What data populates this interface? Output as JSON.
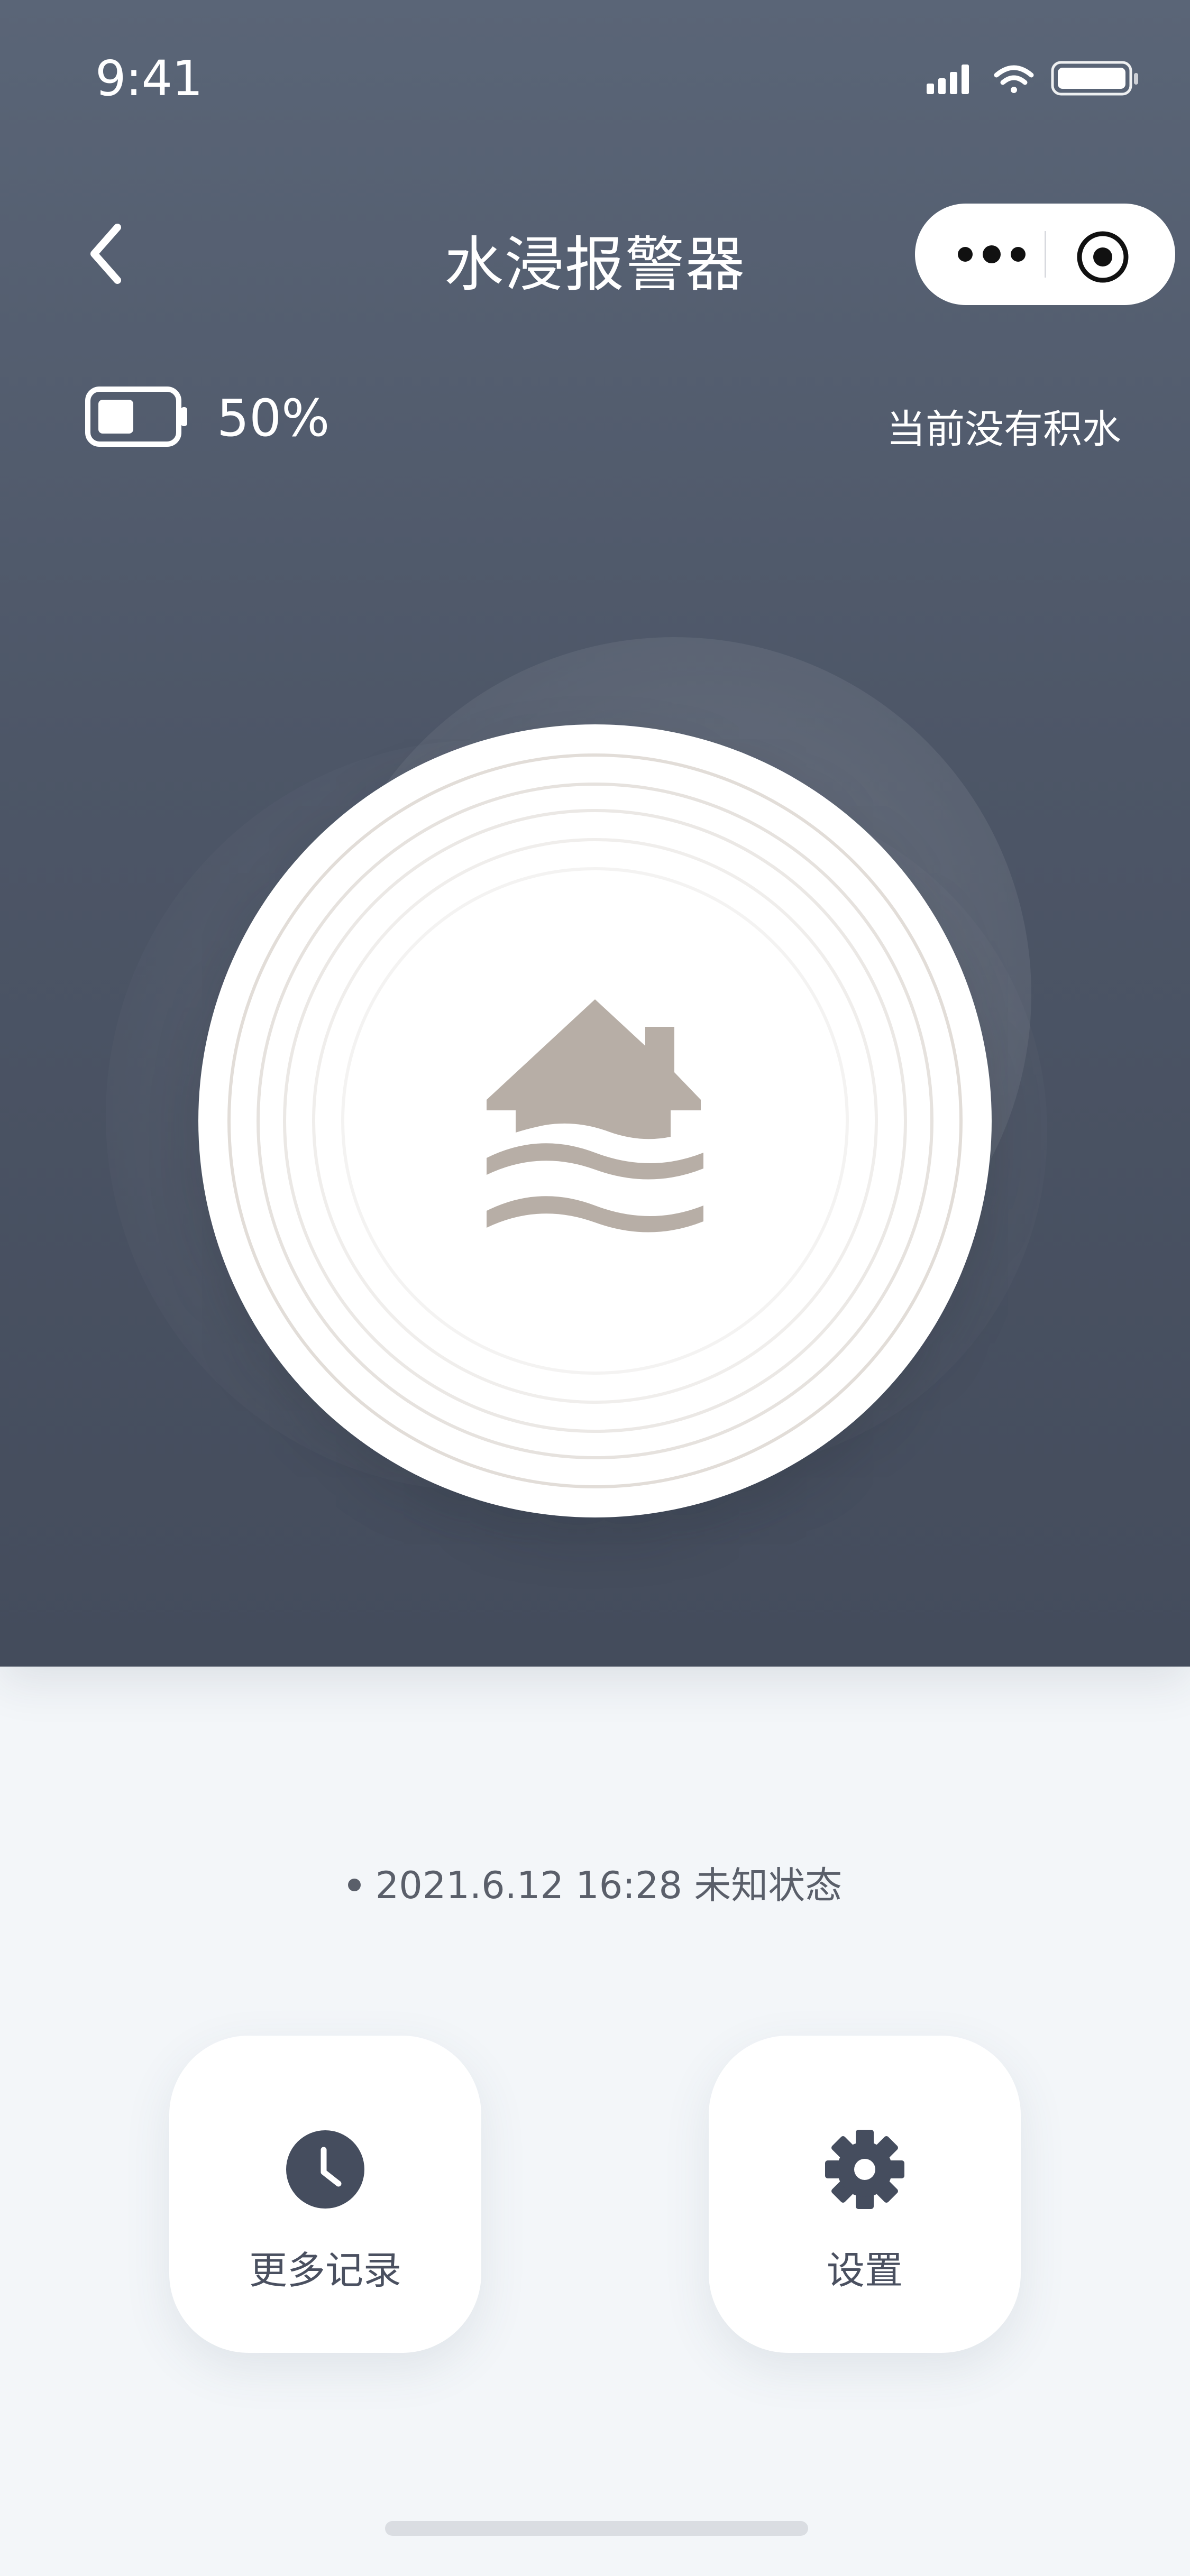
{
  "status_bar": {
    "time": "9:41"
  },
  "nav": {
    "title": "水浸报警器"
  },
  "device": {
    "battery_percent": "50%",
    "battery_level": 0.5,
    "water_status": "当前没有积水"
  },
  "record": {
    "timestamp": "2021.6.12 16:28",
    "state": "未知状态"
  },
  "actions": [
    {
      "label": "更多记录",
      "icon": "clock-icon"
    },
    {
      "label": "设置",
      "icon": "gear-icon"
    }
  ],
  "colors": {
    "hero_top": "#5a6577",
    "hero_bottom": "#444c5c",
    "house": "#b7aea6",
    "ring": "#ddd8d3",
    "page_bg": "#f3f6f9",
    "icon_dark": "#454d5e"
  }
}
